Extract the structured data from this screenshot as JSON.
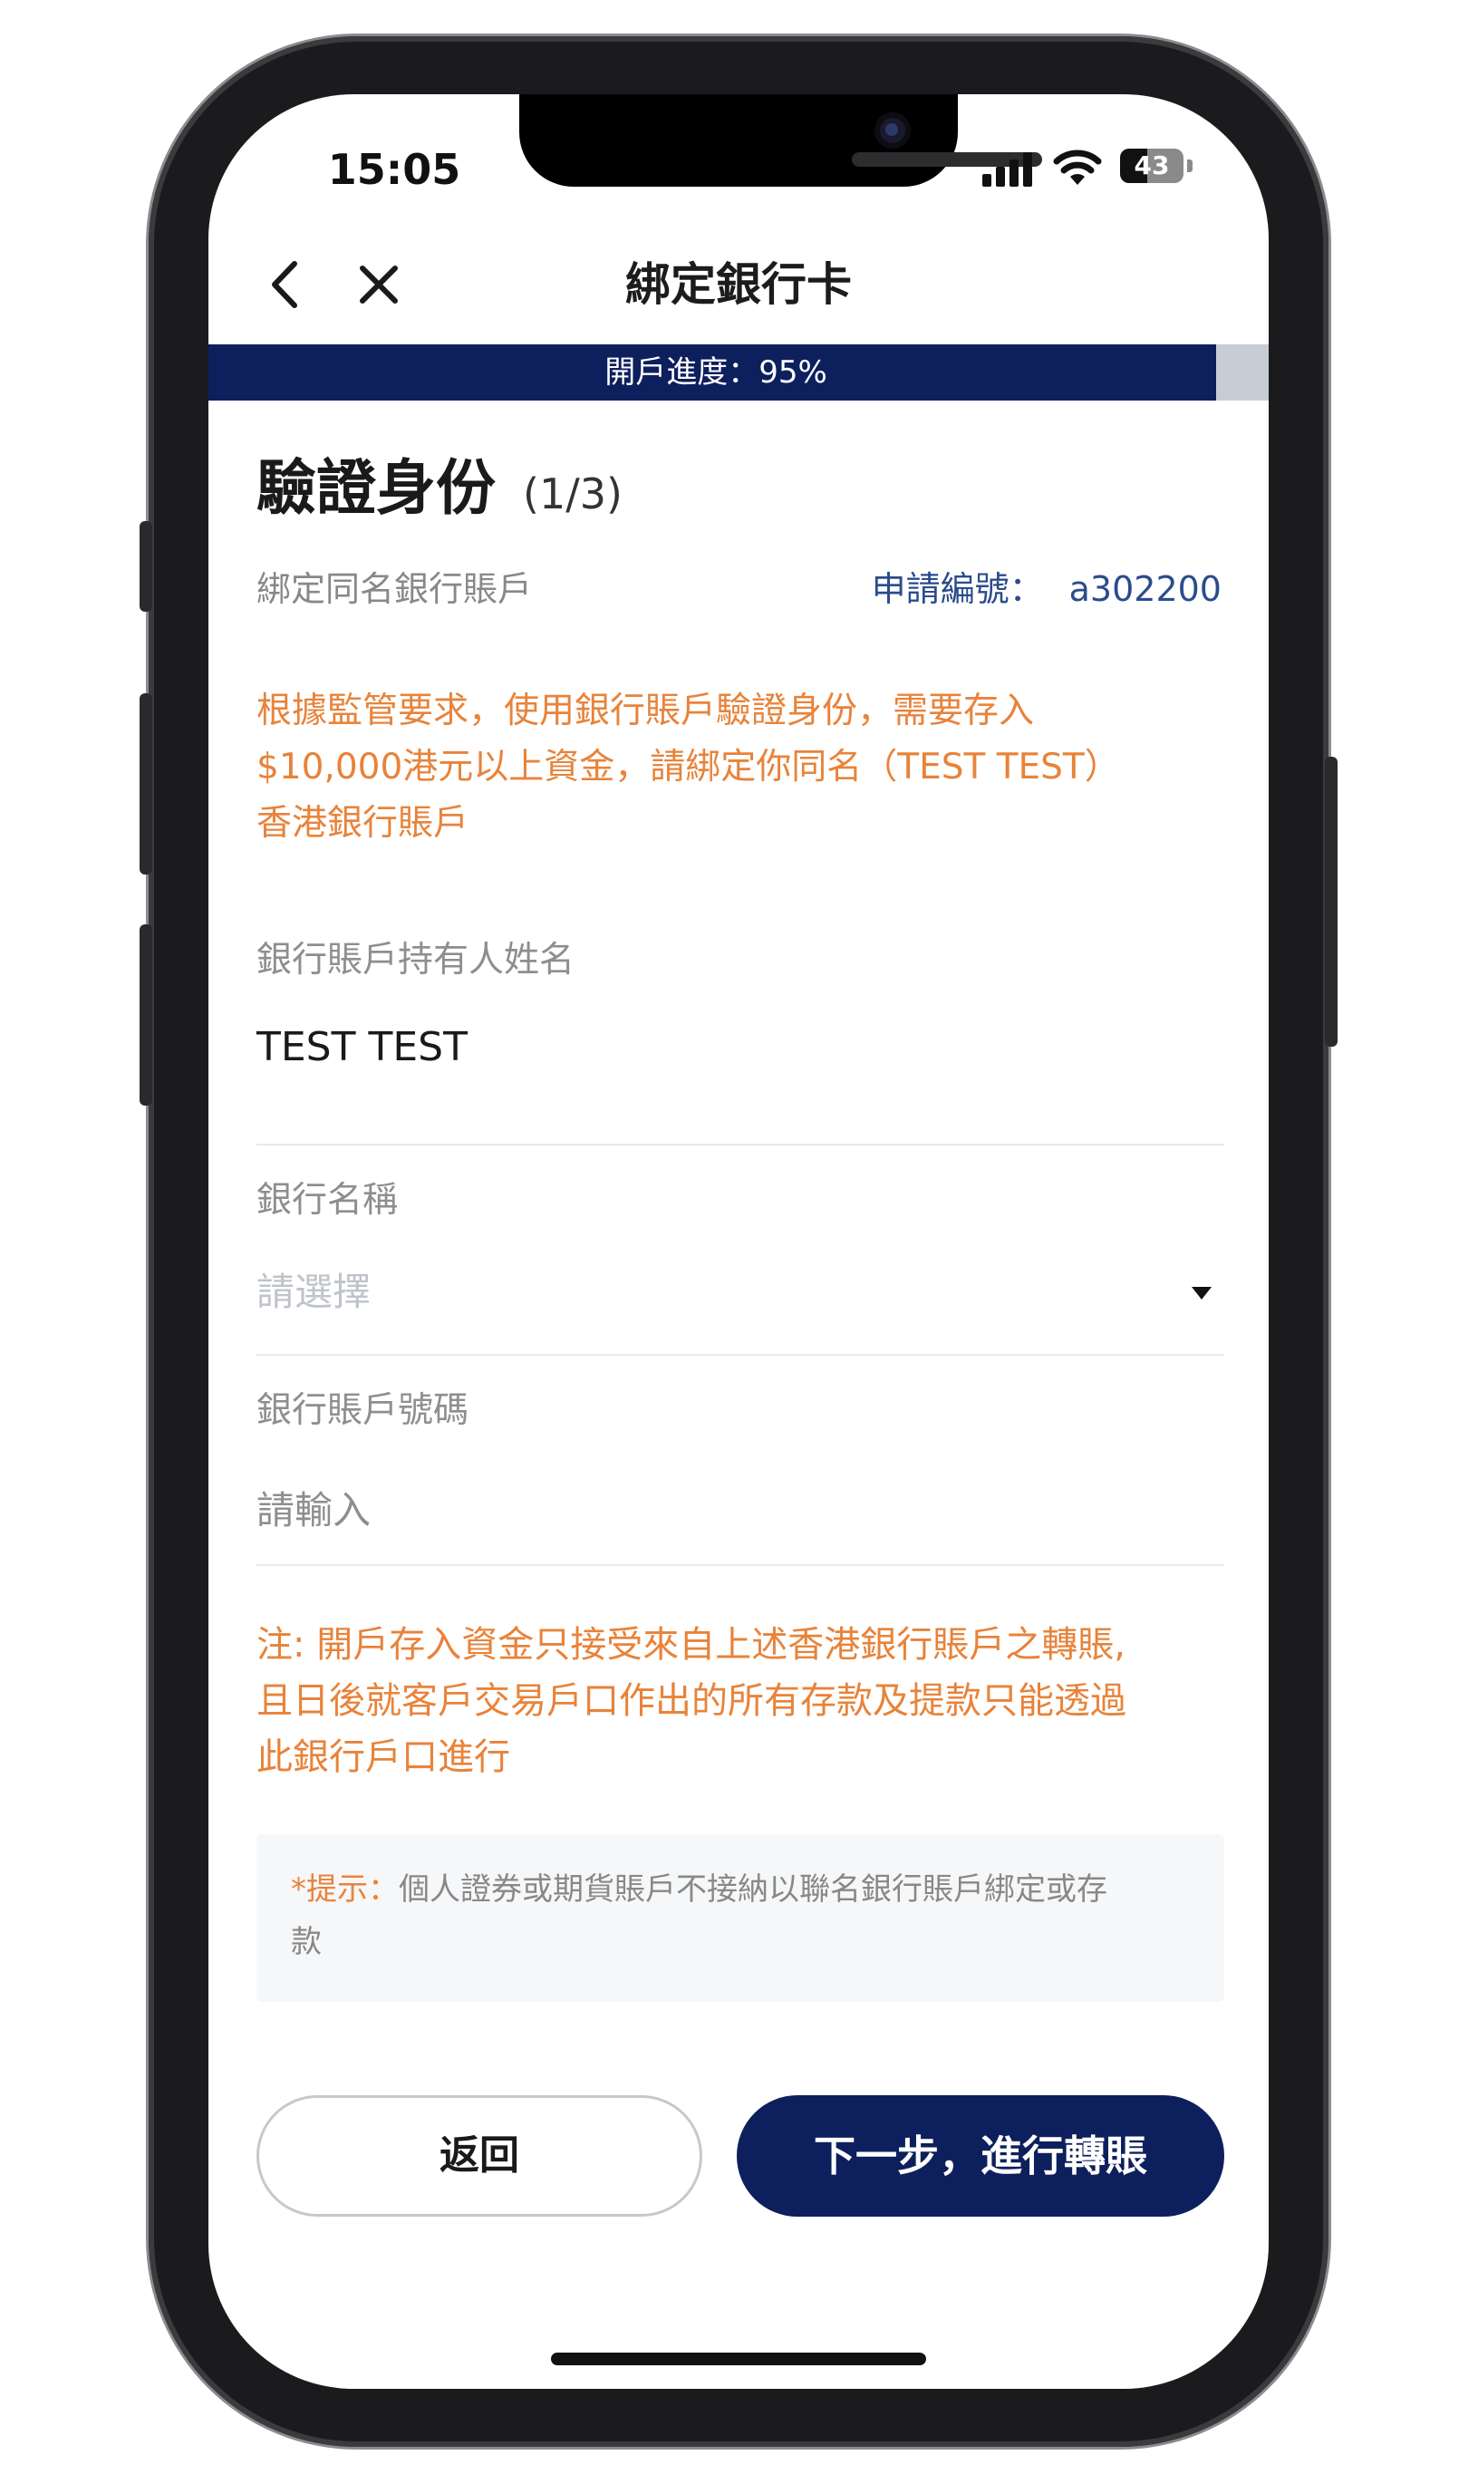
{
  "status_bar": {
    "time": "15:05",
    "battery": "43",
    "battery_level": 0.43
  },
  "nav": {
    "back_icon": "chevron-left-icon",
    "close_icon": "close-icon",
    "title": "綁定銀行卡"
  },
  "progress": {
    "label": "開戶進度：95%",
    "value": 0.95
  },
  "page": {
    "title": "驗證身份",
    "step": "(1/3)",
    "subtitle": "綁定同名銀行賬戶",
    "application_no_label": "申請編號：",
    "application_no_value": "a302200"
  },
  "notice": {
    "lines": [
      "根據監管要求，使用銀行賬戶驗證身份，需要存入",
      "$10,000港元以上資金，請綁定你同名（TEST TEST）",
      "香港銀行賬戶"
    ]
  },
  "form": {
    "holder_label": "銀行賬戶持有人姓名",
    "holder_value": "TEST TEST",
    "bank_label": "銀行名稱",
    "bank_placeholder": "請選擇",
    "account_label": "銀行賬戶號碼",
    "account_placeholder": "請輸入"
  },
  "note": {
    "lines": [
      "注: 開戶存入資金只接受來自上述香港銀行賬戶之轉賬,",
      "且日後就客戶交易戶口作出的所有存款及提款只能透過",
      "此銀行戶口進行"
    ]
  },
  "hint": {
    "prefix": "*提示：",
    "line1": "個人證券或期貨賬戶不接納以聯名銀行賬戶綁定或存",
    "line2": "款"
  },
  "buttons": {
    "back": "返回",
    "next": "下一步，進行轉賬"
  },
  "colors": {
    "primary": "#0d1f5c",
    "warning": "#e8833a",
    "link": "#2b4c8c"
  }
}
